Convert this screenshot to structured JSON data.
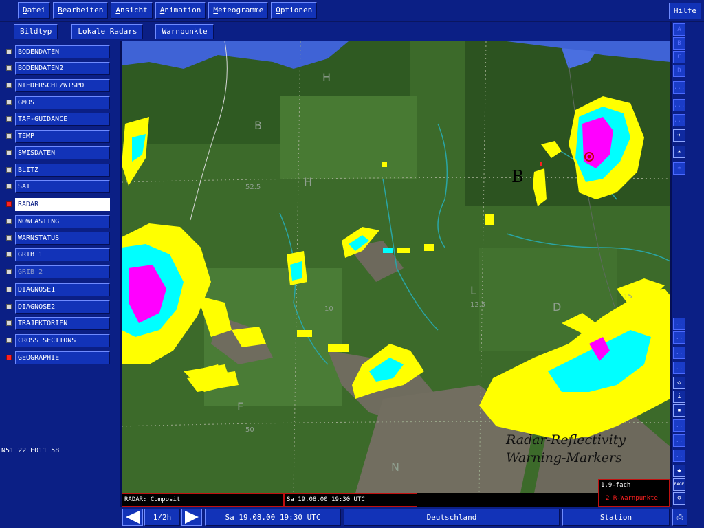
{
  "menu": {
    "items": [
      {
        "first": "D",
        "rest": "atei"
      },
      {
        "first": "B",
        "rest": "earbeiten"
      },
      {
        "first": "A",
        "rest": "nsicht"
      },
      {
        "first": "A",
        "rest": "nimation"
      },
      {
        "first": "M",
        "rest": "eteogramme"
      },
      {
        "first": "O",
        "rest": "ptionen"
      }
    ],
    "help": {
      "first": "H",
      "rest": "ilfe"
    }
  },
  "subbar": {
    "items": [
      "Bildtyp",
      "Lokale Radars",
      "Warnpunkte"
    ]
  },
  "sidebar": {
    "items": [
      {
        "label": "BODENDATEN",
        "checked": false
      },
      {
        "label": "BODENDATEN2",
        "checked": false
      },
      {
        "label": "NIEDERSCHL/WISPO",
        "checked": false
      },
      {
        "label": "GMOS",
        "checked": false
      },
      {
        "label": "TAF-GUIDANCE",
        "checked": false
      },
      {
        "label": "TEMP",
        "checked": false
      },
      {
        "label": "SWISDATEN",
        "checked": false
      },
      {
        "label": "BLITZ",
        "checked": false
      },
      {
        "label": "SAT",
        "checked": false
      },
      {
        "label": "RADAR",
        "checked": true,
        "active": true
      },
      {
        "label": "NOWCASTING",
        "checked": false
      },
      {
        "label": "WARNSTATUS",
        "checked": false
      },
      {
        "label": "GRIB 1",
        "checked": false
      },
      {
        "label": "GRIB 2",
        "checked": false,
        "dim": true
      },
      {
        "label": "DIAGNOSE1",
        "checked": false
      },
      {
        "label": "DIAGNOSE2",
        "checked": false
      },
      {
        "label": "TRAJEKTORIEN",
        "checked": false
      },
      {
        "label": "CROSS SECTIONS",
        "checked": false
      },
      {
        "label": "GEOGRAPHIE",
        "checked": true
      }
    ],
    "coords": "N51 22 E011 58"
  },
  "map": {
    "labels": {
      "h1": "H",
      "h2": "H",
      "b1": "B",
      "b2": "B",
      "l1": "L",
      "d1": "D",
      "f1": "F",
      "n1": "N",
      "lat1": "52.5",
      "lat2": "50",
      "val1": "10",
      "val2": "12.5",
      "val3": "15"
    },
    "overlay_line1": "Radar-Reflectivity",
    "overlay_line2": "Warning-Markers"
  },
  "status": {
    "product": "RADAR: Composit",
    "time": "Sa 19.08.00 19:30 UTC"
  },
  "legend": {
    "line1": "1.9-fach",
    "line2": "2 R-Warnpunkte"
  },
  "bottombar": {
    "step": "1/2h",
    "datetime": "Sa 19.08.00 19:30 UTC",
    "region": "Deutschland",
    "station": "Station"
  },
  "righttools": {
    "top": [
      "A",
      "B",
      "C",
      "D",
      "...",
      "...",
      "..."
    ],
    "bottom": [
      "..",
      "..",
      "..",
      "..",
      "..",
      "..",
      "..",
      "..",
      "..",
      "..",
      "..",
      "PAGE",
      "..",
      ".."
    ]
  },
  "colors": {
    "panel": "#0b1f85",
    "button": "#1233b8",
    "land": "#3c6a2a",
    "water": "#3f63d6",
    "radar_low": "#ffff00",
    "radar_mid": "#00ffff",
    "radar_high": "#ff00ff",
    "warning": "#ff2020"
  }
}
